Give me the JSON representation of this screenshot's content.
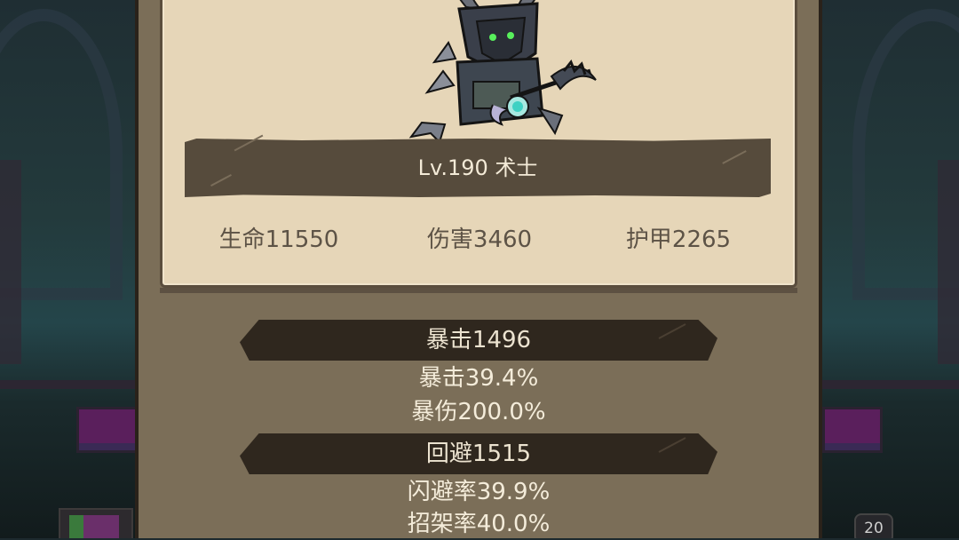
{
  "character": {
    "name_line": "Lv.190 术士",
    "stats": [
      {
        "label": "生命11550"
      },
      {
        "label": "伤害3460"
      },
      {
        "label": "护甲2265"
      }
    ]
  },
  "sections": [
    {
      "header": "暴击1496",
      "lines": [
        "暴击39.4%",
        "暴伤200.0%"
      ]
    },
    {
      "header": "回避1515",
      "lines": [
        "闪避率39.9%",
        "招架率40.0%"
      ]
    }
  ],
  "background": {
    "slot_badge": "20"
  },
  "colors": {
    "panel": "#7b6e58",
    "card": "#e6d6b8",
    "band": "#2f271e",
    "name_band": "#564b3c",
    "text_light": "#f4ecda",
    "text_dark": "#5d5346"
  },
  "icons": {
    "portrait": "warlock-character-portrait"
  }
}
